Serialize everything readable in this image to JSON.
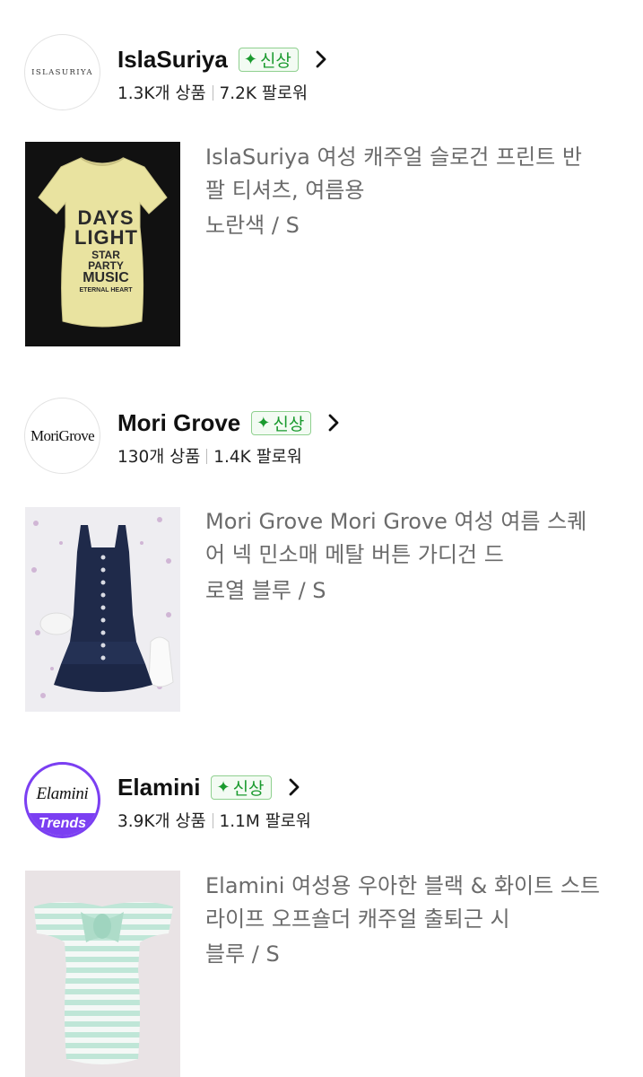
{
  "shops": [
    {
      "name": "IslaSuriya",
      "logo_text": "ISLASURIYA",
      "badge": "신상",
      "products_count": "1.3K개 상품",
      "followers": "7.2K 팔로워",
      "product": {
        "title": "IslaSuriya 여성 캐주얼 슬로건 프린트 반팔 티셔츠, 여름용",
        "variant": "노란색 / S",
        "shirt_text": [
          "DAYS",
          "LIGHT",
          "STAR PARTY",
          "MUSIC",
          "ETERNAL HEART"
        ]
      }
    },
    {
      "name": "Mori Grove",
      "logo_text": "MoriGrove",
      "badge": "신상",
      "products_count": "130개 상품",
      "followers": "1.4K 팔로워",
      "product": {
        "title": "Mori Grove Mori Grove 여성 여름 스퀘어 넥 민소매 메탈 버튼 가디건 드",
        "variant": "로열 블루 / S"
      }
    },
    {
      "name": "Elamini",
      "logo_text": "Elamini",
      "logo_badge": "Trends",
      "badge": "신상",
      "products_count": "3.9K개 상품",
      "followers": "1.1M 팔로워",
      "product": {
        "title": "Elamini 여성용 우아한 블랙 & 화이트 스트라이프 오프숄더 캐주얼 출퇴근 시",
        "variant": "블루 / S"
      }
    }
  ],
  "colors": {
    "badge_green": "#1a9a2e",
    "elamini_purple": "#7b3ff2",
    "muted_text": "#6b6b6b"
  }
}
